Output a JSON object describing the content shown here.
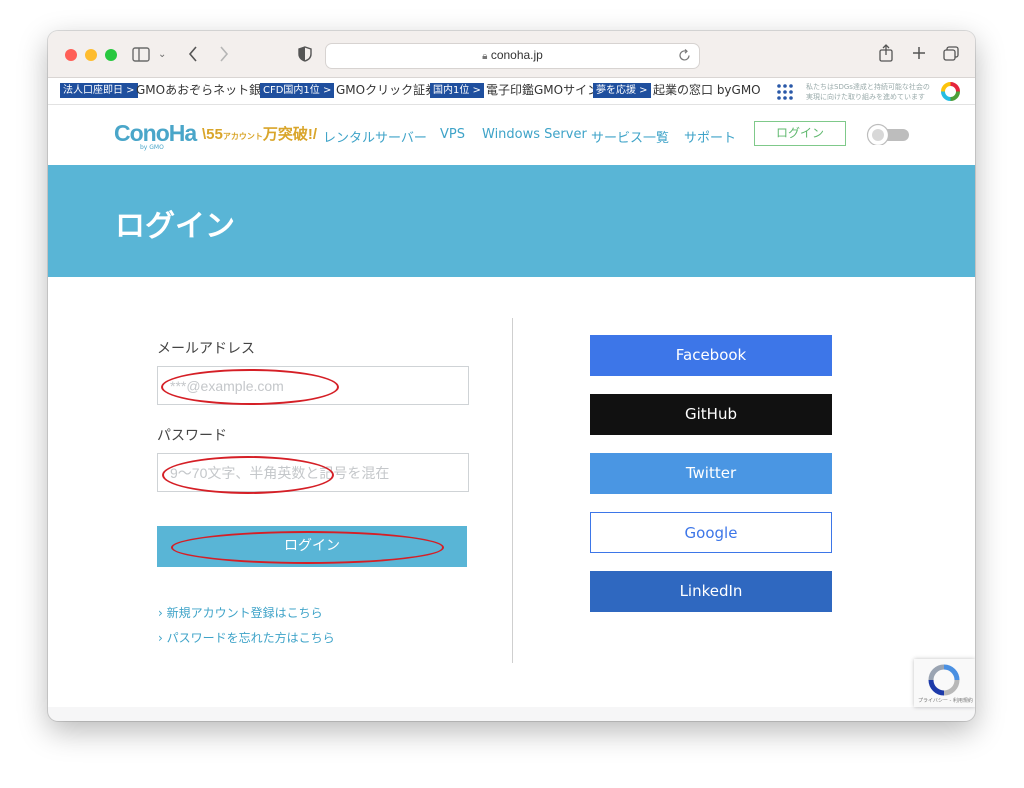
{
  "browser": {
    "url": "conoha.jp",
    "colors": {
      "close": "#ff5f57",
      "minimize": "#febc2e",
      "maximize": "#28c840"
    }
  },
  "bookmarks": [
    {
      "tag": "法人口座即日 >",
      "label": "GMOあおぞらネット銀行"
    },
    {
      "tag": "CFD国内1位 >",
      "label": "GMOクリック証券"
    },
    {
      "tag": "国内1位 >",
      "label": "電子印鑑GMOサイン"
    },
    {
      "tag": "夢を応援 >",
      "label": "起業の窓口 byGMO"
    }
  ],
  "sdgs_text": [
    "私たちはSDGs達成と持続可能な社会の",
    "実現に向けた取り組みを進めています"
  ],
  "header": {
    "logo": "ConoHa",
    "logo_sub": "by GMO",
    "badge_number": "55",
    "badge_small_top": "アカウント",
    "badge_text": "万突破!",
    "nav": [
      "レンタルサーバー",
      "VPS",
      "Windows Server",
      "サービス一覧",
      "サポート"
    ],
    "login_label": "ログイン"
  },
  "hero": {
    "title": "ログイン"
  },
  "form": {
    "email_label": "メールアドレス",
    "email_placeholder": "***@example.com",
    "password_label": "パスワード",
    "password_placeholder": "9〜70文字、半角英数と記号を混在",
    "submit_label": "ログイン",
    "links": [
      "新規アカウント登録はこちら",
      "パスワードを忘れた方はこちら"
    ]
  },
  "social": [
    {
      "label": "Facebook",
      "color": "#3d76e8"
    },
    {
      "label": "GitHub",
      "color": "#111111"
    },
    {
      "label": "Twitter",
      "color": "#4a96e3"
    },
    {
      "label": "Google",
      "color": "#ffffff"
    },
    {
      "label": "LinkedIn",
      "color": "#2f68c0"
    }
  ],
  "recaptcha": {
    "text": "プライバシー - 利用規約"
  },
  "colors": {
    "accent": "#59b5d6",
    "annotation": "#d51f26"
  }
}
